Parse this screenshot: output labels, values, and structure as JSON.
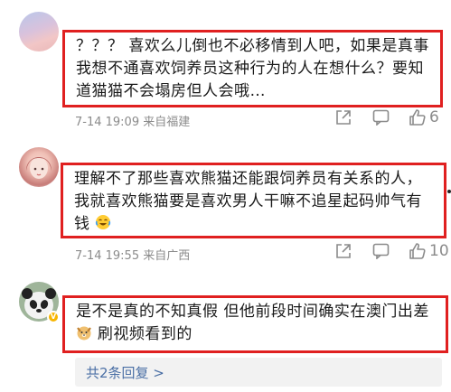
{
  "comments": [
    {
      "text": "？？？ 喜欢么儿倒也不必移情到人吧，如果是真事我想不通喜欢饲养员这种行为的人在想什么？要知道猫猫不会塌房但人会哦…",
      "meta": "7-14 19:09  来自福建",
      "likes": "6"
    },
    {
      "text_main": "理解不了那些喜欢熊猫还能跟饲养员有关系的人，我就喜欢熊猫要是喜欢男人干嘛不追星起码帅气有钱",
      "emoji": "laughing-crying-emoji",
      "meta": "7-14 19:55  来自广西",
      "likes": "10"
    },
    {
      "text_part1": "是不是真的不知真假  但他前段时间确实在澳门出差",
      "emoji": "dog-face-emoji",
      "text_part2": "刷视频看到的",
      "badge": "V"
    }
  ],
  "reply": {
    "label": "共2条回复 >"
  },
  "colors": {
    "highlight_border": "#e02020",
    "meta_text": "#8b8b8b",
    "reply_link": "#4a6fa5"
  }
}
